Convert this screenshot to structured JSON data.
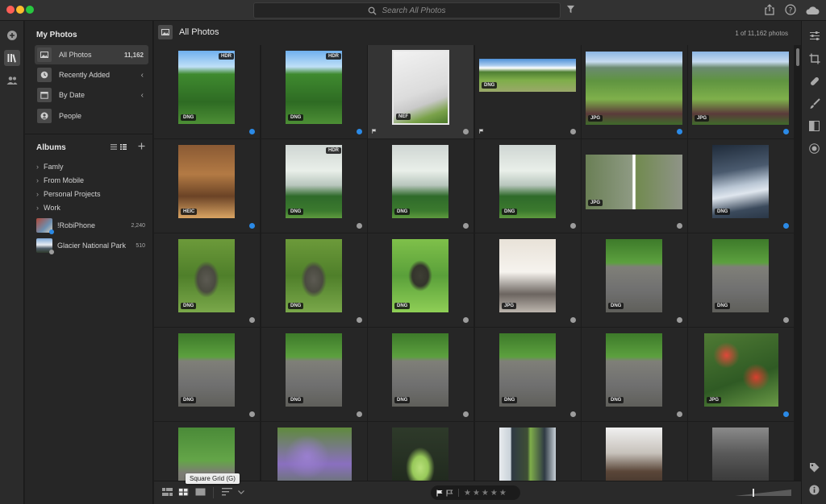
{
  "search": {
    "placeholder": "Search All Photos"
  },
  "sidebar": {
    "my_photos_heading": "My Photos",
    "items": [
      {
        "label": "All Photos",
        "count": "11,162",
        "icon": "photos-icon",
        "active": true
      },
      {
        "label": "Recently Added",
        "icon": "clock-icon",
        "chevron": "‹"
      },
      {
        "label": "By Date",
        "icon": "calendar-icon",
        "chevron": "‹"
      },
      {
        "label": "People",
        "icon": "person-icon"
      }
    ],
    "albums_heading": "Albums",
    "album_folders": [
      "Famly",
      "From Mobile",
      "Personal Projects",
      "Work"
    ],
    "albums": [
      {
        "label": "!RobiPhone",
        "count": "2,240"
      },
      {
        "label": "Glacier National Park",
        "count": "510"
      }
    ]
  },
  "main": {
    "title": "All Photos",
    "count": "1 of 11,162 photos"
  },
  "grid": {
    "rows": [
      [
        {
          "badge_top": "HDR",
          "badge": "DNG",
          "mark": "blue",
          "photo": "trees-sky"
        },
        {
          "badge_top": "HDR",
          "badge": "DNG",
          "mark": "blue",
          "photo": "trees-sky"
        },
        {
          "badge": "NEF",
          "mark": "gray",
          "flag": true,
          "photo": "slide",
          "selected": true
        },
        {
          "badge": "DNG",
          "mark": "gray",
          "flag": true,
          "photo": "aerial-wide"
        },
        {
          "badge": "JPG",
          "mark": "blue",
          "photo": "aerial-house"
        },
        {
          "badge": "JPG",
          "mark": "blue",
          "photo": "aerial-house"
        }
      ],
      [
        {
          "badge": "HEIC",
          "mark": "blue",
          "photo": "room"
        },
        {
          "badge_top": "HDR",
          "badge": "DNG",
          "mark": "gray",
          "photo": "cloud-trees"
        },
        {
          "badge": "DNG",
          "mark": "gray",
          "photo": "cloud-trees"
        },
        {
          "badge": "DNG",
          "mark": "gray",
          "photo": "cloud-trees"
        },
        {
          "badge": "JPG",
          "mark": "gray",
          "photo": "rock-split"
        },
        {
          "badge": "DNG",
          "mark": "blue",
          "photo": "storm"
        }
      ],
      [
        {
          "badge": "DNG",
          "mark": "gray",
          "photo": "turtle"
        },
        {
          "badge": "DNG",
          "mark": "gray",
          "photo": "turtle"
        },
        {
          "badge": "DNG",
          "mark": "gray",
          "photo": "turtle-green"
        },
        {
          "badge": "JPG",
          "mark": "gray",
          "photo": "shirt-card"
        },
        {
          "badge": "DNG",
          "mark": "gray",
          "photo": "rock"
        },
        {
          "badge": "DNG",
          "mark": "gray",
          "photo": "rock"
        }
      ],
      [
        {
          "badge": "DNG",
          "mark": "gray",
          "photo": "rock"
        },
        {
          "badge": "DNG",
          "mark": "gray",
          "photo": "rock"
        },
        {
          "badge": "DNG",
          "mark": "gray",
          "photo": "rock"
        },
        {
          "badge": "DNG",
          "mark": "gray",
          "photo": "rock"
        },
        {
          "badge": "DNG",
          "mark": "gray",
          "photo": "rock"
        },
        {
          "badge": "JPG",
          "mark": "blue",
          "photo": "red-flowers"
        }
      ],
      [
        {
          "photo": "rock-tree"
        },
        {
          "photo": "lavender"
        },
        {
          "photo": "moth-dark"
        },
        {
          "photo": "moth-window"
        },
        {
          "photo": "person-fence"
        },
        {
          "photo": "person-fence-gray"
        }
      ]
    ]
  },
  "bottombar": {
    "tooltip": "Square Grid (G)",
    "stars": "★★★★★"
  },
  "colors": {
    "accent_blue": "#2b8ae6",
    "panel": "#262626",
    "background": "#1e1e1e"
  }
}
